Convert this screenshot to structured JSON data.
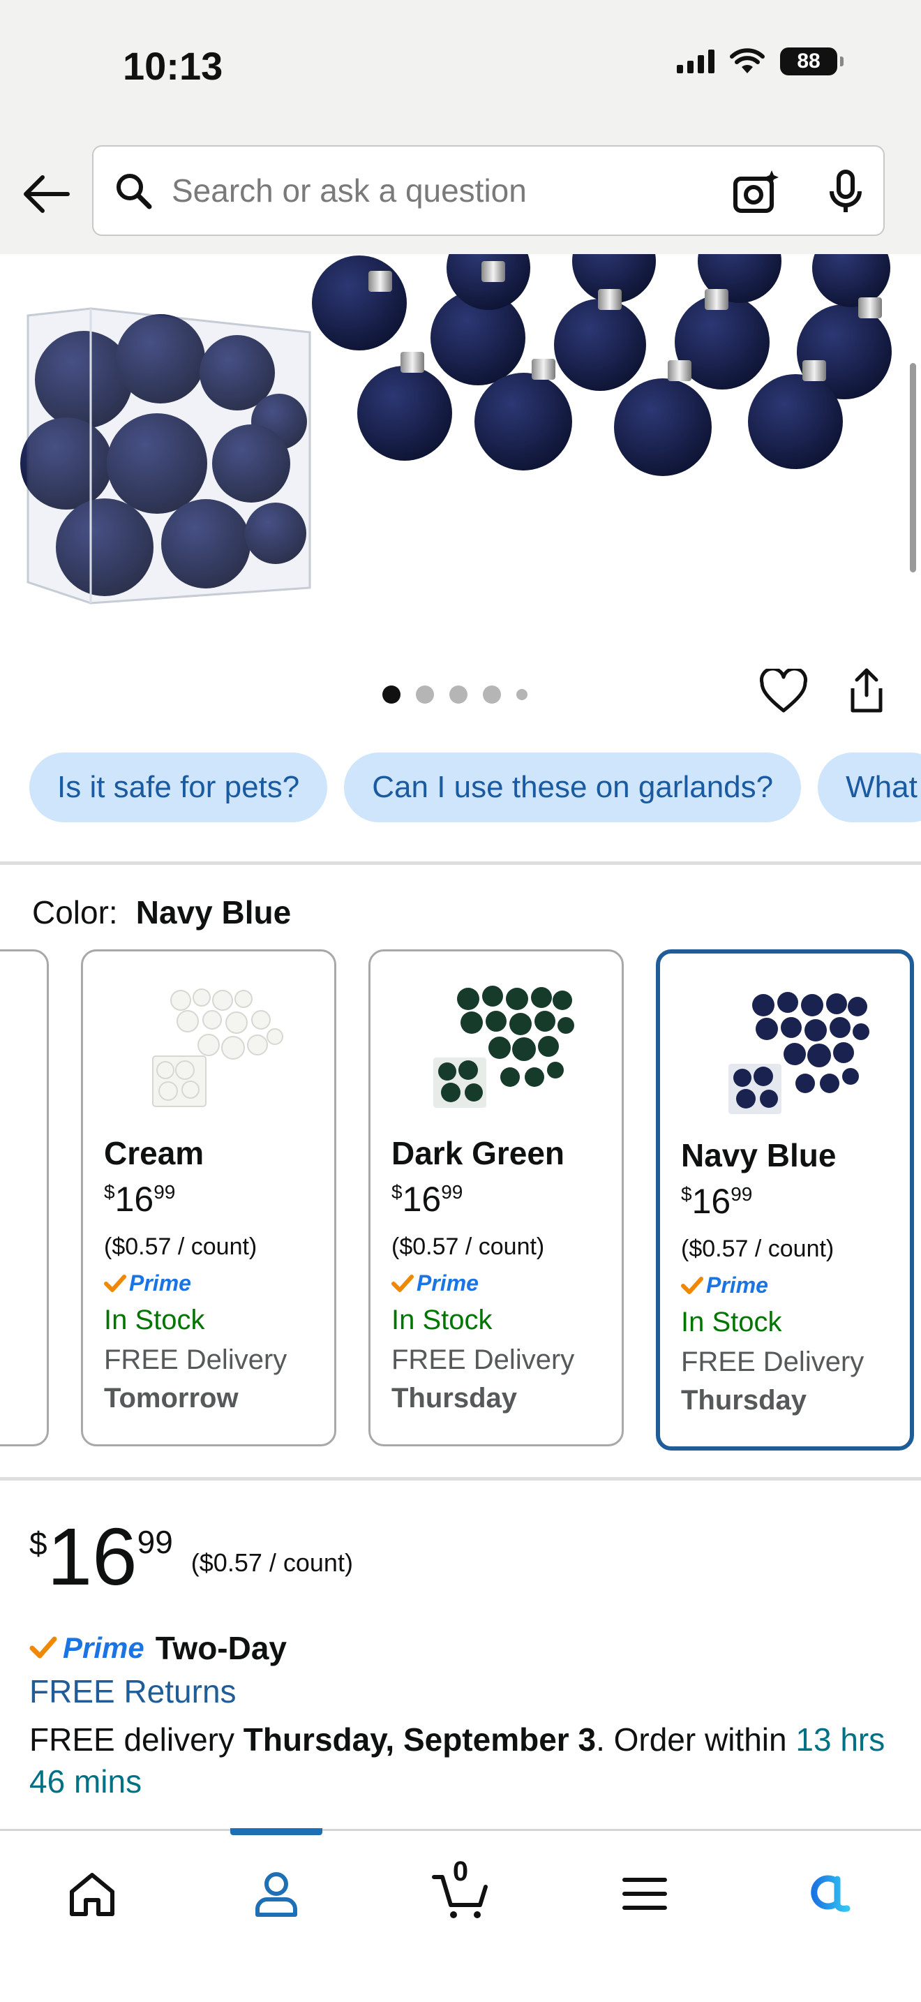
{
  "status_bar": {
    "time": "10:13",
    "battery": "88"
  },
  "search": {
    "placeholder": "Search or ask a question",
    "value": ""
  },
  "product_image": {
    "carousel_dots": 5,
    "active_index": 0
  },
  "questions": [
    "Is it safe for pets?",
    "Can I use these on garlands?",
    "What"
  ],
  "color": {
    "label": "Color:",
    "selected": "Navy Blue"
  },
  "variants": [
    {
      "name": "Cream",
      "currency": "$",
      "whole": "16",
      "fraction": "99",
      "unit_price": "($0.57 / count)",
      "prime": "Prime",
      "stock": "In Stock",
      "delivery": "FREE Delivery",
      "day": "Tomorrow",
      "swatch": "#f4f4f1"
    },
    {
      "name": "Dark Green",
      "currency": "$",
      "whole": "16",
      "fraction": "99",
      "unit_price": "($0.57 / count)",
      "prime": "Prime",
      "stock": "In Stock",
      "delivery": "FREE Delivery",
      "day": "Thursday",
      "swatch": "#173b2a"
    },
    {
      "name": "Navy Blue",
      "currency": "$",
      "whole": "16",
      "fraction": "99",
      "unit_price": "($0.57 / count)",
      "prime": "Prime",
      "stock": "In Stock",
      "delivery": "FREE Delivery",
      "day": "Thursday",
      "swatch": "#1a2250",
      "selected": true
    }
  ],
  "price": {
    "currency": "$",
    "whole": "16",
    "fraction": "99",
    "unit_price": "($0.57 / count)"
  },
  "shipping": {
    "prime": "Prime",
    "speed": "Two-Day",
    "returns": "FREE Returns",
    "delivery_prefix": "FREE delivery ",
    "delivery_date": "Thursday, September 3",
    "order_within": ". Order within ",
    "timer": "13 hrs 46 mins"
  },
  "bottom_nav": {
    "cart_count": "0",
    "active": "account"
  },
  "colors": {
    "prime_blue": "#1b74e4",
    "chip_bg": "#cfe5fb",
    "selected_border": "#1f5c98",
    "in_stock": "#007600",
    "ornament_navy": "#1a2250"
  }
}
